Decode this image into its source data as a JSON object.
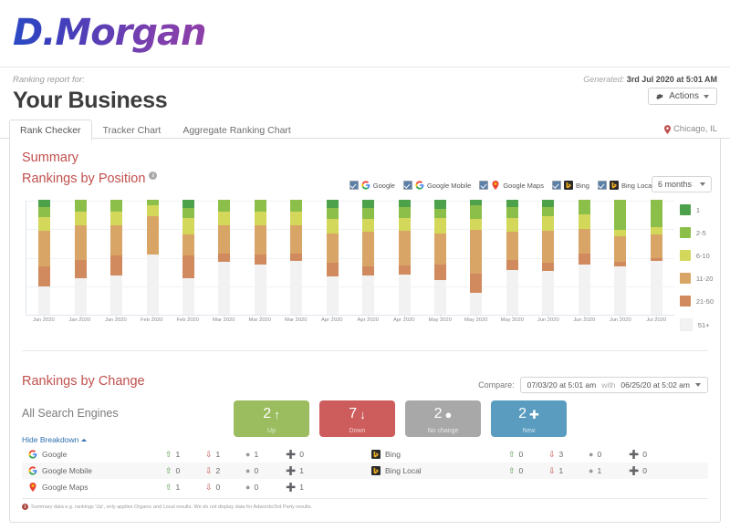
{
  "brand": {
    "logo_text": "D.Morgan"
  },
  "header": {
    "ranking_for_label": "Ranking report for:",
    "business_name": "Your Business",
    "generated_prefix": "Generated:",
    "generated_value": "3rd Jul 2020 at 5:01 AM",
    "actions_label": "Actions",
    "location": "Chicago, IL"
  },
  "tabs": [
    {
      "label": "Rank Checker",
      "active": true
    },
    {
      "label": "Tracker Chart",
      "active": false
    },
    {
      "label": "Aggregate Ranking Chart",
      "active": false
    }
  ],
  "summary": {
    "title": "Summary",
    "rankings_by_position_title": "Rankings by Position",
    "info_glyph": "i",
    "period_label": "6 months"
  },
  "engine_legend": [
    {
      "label": "Google",
      "icon": "google-icon",
      "checked": true
    },
    {
      "label": "Google Mobile",
      "icon": "google-icon",
      "checked": true
    },
    {
      "label": "Google Maps",
      "icon": "google-maps-pin-icon",
      "checked": true
    },
    {
      "label": "Bing",
      "icon": "bing-icon",
      "checked": true
    },
    {
      "label": "Bing Local",
      "icon": "bing-icon",
      "checked": true
    }
  ],
  "position_legend": [
    {
      "label": "1",
      "color": "#4da14b"
    },
    {
      "label": "2-5",
      "color": "#8cbf4a"
    },
    {
      "label": "6-10",
      "color": "#d3d85a"
    },
    {
      "label": "11-20",
      "color": "#d9a566"
    },
    {
      "label": "21-50",
      "color": "#d08a5e"
    },
    {
      "label": "51+",
      "color": "#f2f2f2"
    }
  ],
  "chart_data": {
    "type": "bar",
    "title": "Rankings by Position",
    "xlabel": "",
    "ylabel": "",
    "stacked": true,
    "grid": true,
    "legend_position": "right",
    "ylim": [
      0,
      100
    ],
    "series_order": [
      "1",
      "2-5",
      "6-10",
      "11-20",
      "21-50",
      "51+"
    ],
    "colors": {
      "1": "#4da14b",
      "2-5": "#8cbf4a",
      "6-10": "#d3d85a",
      "11-20": "#d9a566",
      "21-50": "#d08a5e",
      "51+": "#f2f2f2"
    },
    "categories": [
      "Jan 2020",
      "Jan 2020",
      "Jan 2020",
      "Feb 2020",
      "Feb 2020",
      "Mar 2020",
      "Mar 2020",
      "Mar 2020",
      "Apr 2020",
      "Apr 2020",
      "Apr 2020",
      "May 2020",
      "May 2020",
      "May 2020",
      "Jun 2020",
      "Jun 2020",
      "Jun 2020",
      "Jul 2020"
    ],
    "series": [
      {
        "name": "1",
        "values": [
          6,
          0,
          0,
          0,
          7,
          0,
          0,
          0,
          7,
          7,
          6,
          8,
          5,
          6,
          6,
          0,
          0,
          0
        ]
      },
      {
        "name": "2-5",
        "values": [
          9,
          10,
          10,
          5,
          9,
          10,
          10,
          10,
          10,
          10,
          10,
          8,
          12,
          10,
          8,
          13,
          26,
          24
        ]
      },
      {
        "name": "6-10",
        "values": [
          12,
          12,
          12,
          9,
          14,
          12,
          12,
          12,
          12,
          11,
          11,
          13,
          9,
          12,
          13,
          12,
          6,
          6
        ]
      },
      {
        "name": "11-20",
        "values": [
          31,
          30,
          26,
          34,
          18,
          25,
          26,
          25,
          26,
          30,
          30,
          27,
          38,
          24,
          28,
          22,
          22,
          21
        ]
      },
      {
        "name": "21-50",
        "values": [
          17,
          16,
          18,
          0,
          20,
          7,
          8,
          6,
          12,
          8,
          8,
          14,
          17,
          9,
          7,
          9,
          4,
          2
        ]
      },
      {
        "name": "51+",
        "values": [
          25,
          32,
          34,
          52,
          32,
          46,
          44,
          47,
          33,
          34,
          35,
          30,
          19,
          39,
          38,
          44,
          42,
          47
        ]
      }
    ]
  },
  "rankings_by_change": {
    "title": "Rankings by Change",
    "all_engines_label": "All Search Engines",
    "hide_breakdown_label": "Hide Breakdown",
    "compare_label": "Compare:",
    "compare_from": "07/03/20 at 5:01 am",
    "compare_with": "with",
    "compare_to": "06/25/20 at 5:02 am",
    "tiles": [
      {
        "value": "2",
        "glyph": "↑",
        "caption": "Up",
        "color": "#9bbd5f",
        "name": "up-tile"
      },
      {
        "value": "7",
        "glyph": "↓",
        "caption": "Down",
        "color": "#cd5c5c",
        "name": "down-tile"
      },
      {
        "value": "2",
        "glyph": "●",
        "caption": "No change",
        "color": "#a8a8a8",
        "name": "no-change-tile"
      },
      {
        "value": "2",
        "glyph": "✚",
        "caption": "New",
        "color": "#5a9cc0",
        "name": "new-tile"
      }
    ],
    "breakdown_left": [
      {
        "engine": "Google",
        "icon": "google-icon",
        "up": "1",
        "down": "1",
        "no_change": "1",
        "new": "0"
      },
      {
        "engine": "Google Mobile",
        "icon": "google-icon",
        "up": "0",
        "down": "2",
        "no_change": "0",
        "new": "1"
      },
      {
        "engine": "Google Maps",
        "icon": "google-maps-pin-icon",
        "up": "1",
        "down": "0",
        "no_change": "0",
        "new": "1"
      }
    ],
    "breakdown_right": [
      {
        "engine": "Bing",
        "icon": "bing-icon",
        "up": "0",
        "down": "3",
        "no_change": "0",
        "new": "0"
      },
      {
        "engine": "Bing Local",
        "icon": "bing-icon",
        "up": "0",
        "down": "1",
        "no_change": "1",
        "new": "0"
      }
    ]
  },
  "footnote": {
    "text": "Summary data e.g. rankings 'Up', only applies Organic and Local results. We do not display data for Adwords/3rd Party results."
  }
}
